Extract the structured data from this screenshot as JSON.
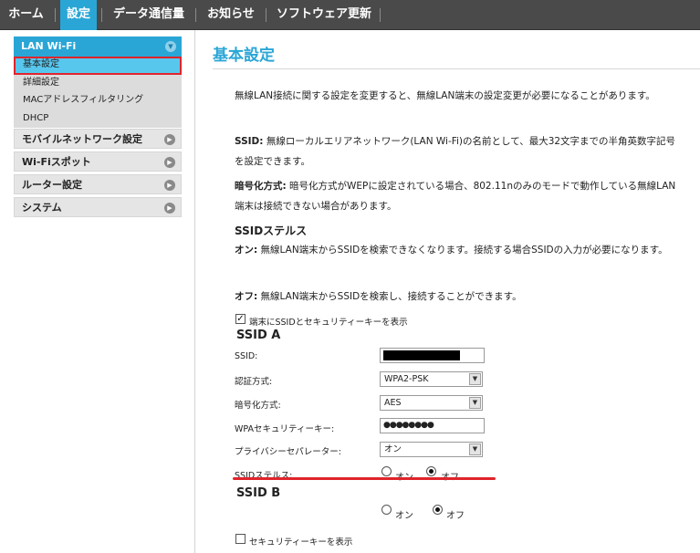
{
  "nav": {
    "items": [
      "ホーム",
      "設定",
      "データ通信量",
      "お知らせ",
      "ソフトウェア更新"
    ],
    "active_index": 1
  },
  "sidebar": {
    "lan_wifi": "LAN Wi-Fi",
    "sub_items": [
      "基本設定",
      "詳細設定",
      "MACアドレスフィルタリング",
      "DHCP"
    ],
    "groups": [
      "モバイルネットワーク設定",
      "Wi-Fiスポット",
      "ルーター設定",
      "システム"
    ]
  },
  "main": {
    "title": "基本設定",
    "intro": "無線LAN接続に関する設定を変更すると、無線LAN端末の設定変更が必要になることがあります。",
    "ssid_desc_label": "SSID:",
    "ssid_desc": " 無線ローカルエリアネットワーク(LAN Wi-Fi)の名前として、最大32文字までの半角英数字記号を設定できます。",
    "enc_desc_label": "暗号化方式:",
    "enc_desc": " 暗号化方式がWEPに設定されている場合、802.11nのみのモードで動作している無線LAN端末は接続できない場合があります。",
    "stealth_heading": "SSIDステルス",
    "stealth_on_label": "オン:",
    "stealth_on_desc": " 無線LAN端末からSSIDを検索できなくなります。接続する場合SSIDの入力が必要になります。",
    "stealth_off_label": "オフ:",
    "stealth_off_desc": " 無線LAN端末からSSIDを検索し、接続することができます。",
    "show_key_checkbox": "端末にSSIDとセキュリティーキーを表示",
    "ssid_a": {
      "heading": "SSID A",
      "ssid_label": "SSID:",
      "auth_label": "認証方式:",
      "auth_value": "WPA2-PSK",
      "enc_label": "暗号化方式:",
      "enc_value": "AES",
      "key_label": "WPAセキュリティーキー:",
      "key_value": "●●●●●●●●",
      "privacy_label": "プライバシーセパレーター:",
      "privacy_value": "オン",
      "stealth_label": "SSIDステルス:",
      "radio_on": "オン",
      "radio_off": "オフ"
    },
    "ssid_b": {
      "heading": "SSID B",
      "radio_on": "オン",
      "radio_off": "オフ"
    },
    "show_security_key": "セキュリティーキーを表示"
  }
}
